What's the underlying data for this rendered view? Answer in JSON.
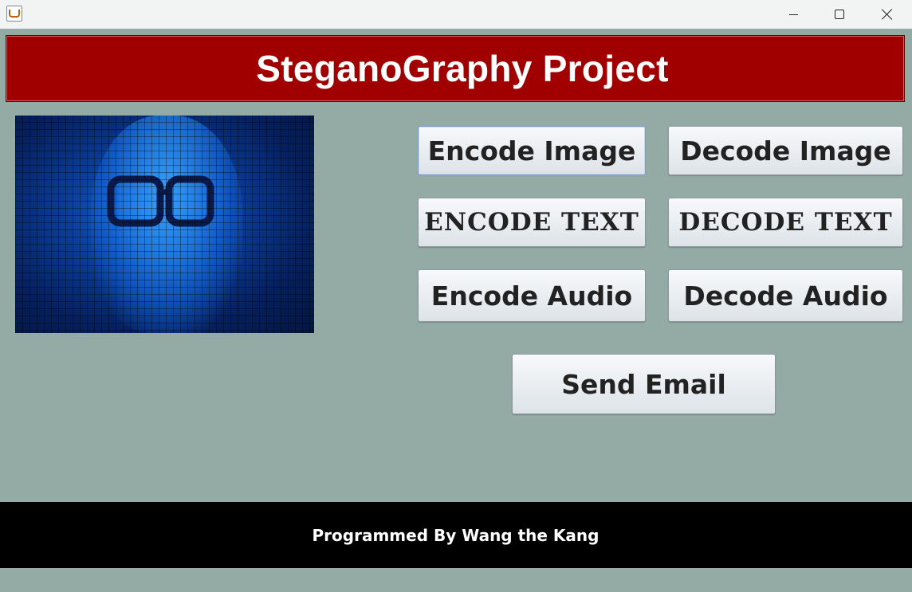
{
  "window": {
    "title": ""
  },
  "header": {
    "title": "SteganoGraphy Project"
  },
  "buttons": {
    "encode_image": "Encode Image",
    "decode_image": "Decode Image",
    "encode_text": "ENCODE TEXT",
    "decode_text": "DECODE TEXT",
    "encode_audio": "Encode Audio",
    "decode_audio": "Decode Audio",
    "send_email": "Send Email"
  },
  "footer": {
    "text": "Programmed By Wang the Kang"
  },
  "icons": {
    "app": "java-cup-icon",
    "minimize": "minimize-icon",
    "maximize": "maximize-icon",
    "close": "close-icon"
  },
  "colors": {
    "background": "#94aaa4",
    "header": "#a00000",
    "footer": "#000000",
    "hero_blue": "#0b3f9a"
  }
}
